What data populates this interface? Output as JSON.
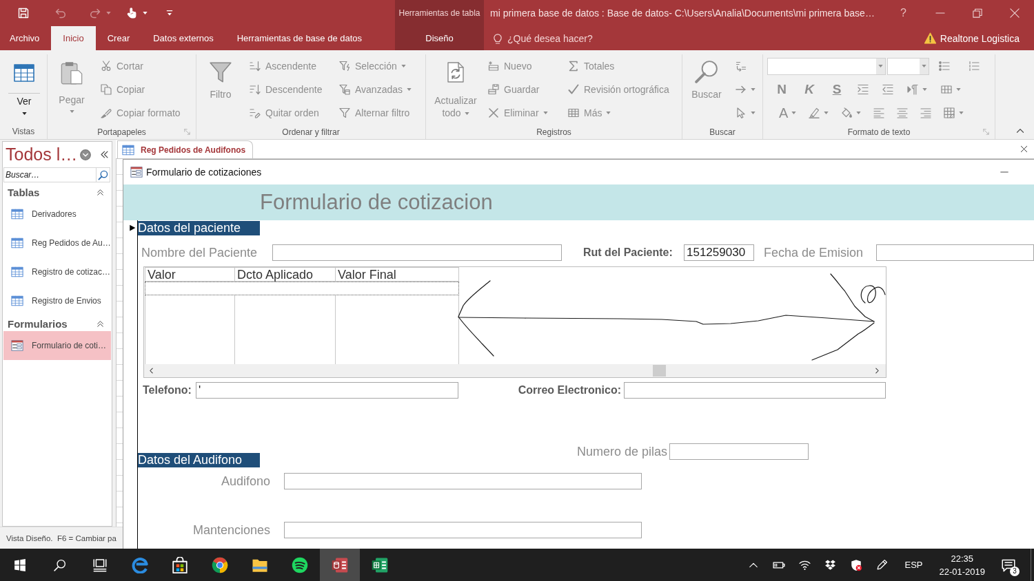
{
  "title_bar": {
    "context_group": "Herramientas de tabla",
    "title": "mi primera base de datos : Base de datos- C:\\Users\\Analia\\Documents\\mi primera base…",
    "help": "?"
  },
  "quick_access": [
    {
      "disabled": false
    },
    {
      "disabled": true
    },
    {
      "disabled": true
    },
    {
      "disabled": false
    }
  ],
  "ribbon_tabs": [
    {
      "label": "Archivo",
      "kind": "main",
      "selected": false
    },
    {
      "label": "Inicio",
      "kind": "main",
      "selected": true
    },
    {
      "label": "Crear",
      "kind": "main",
      "selected": false
    },
    {
      "label": "Datos externos",
      "kind": "main",
      "selected": false
    },
    {
      "label": "Herramientas de base de datos",
      "kind": "main",
      "selected": false
    },
    {
      "label": "Diseño",
      "kind": "context",
      "selected": false
    }
  ],
  "tell_me": {
    "placeholder": "¿Qué desea hacer?"
  },
  "account": {
    "name": "Realtone Logistica"
  },
  "ribbon_groups": [
    {
      "label": "Vistas",
      "launcher": false,
      "commands": [
        {
          "label": "Ver",
          "disabled": false
        }
      ]
    },
    {
      "label": "Portapapeles",
      "launcher": true,
      "commands": [
        {
          "label": "Pegar",
          "disabled": true
        },
        {
          "label": "Cortar",
          "disabled": true
        },
        {
          "label": "Copiar",
          "disabled": true
        },
        {
          "label": "Copiar formato",
          "disabled": true
        }
      ]
    },
    {
      "label": "Ordenar y filtrar",
      "launcher": false,
      "commands": [
        {
          "label": "Filtro",
          "disabled": true
        },
        {
          "label": "Ascendente",
          "disabled": true
        },
        {
          "label": "Descendente",
          "disabled": true
        },
        {
          "label": "Quitar orden",
          "disabled": true
        },
        {
          "label": "Selección",
          "disabled": true
        },
        {
          "label": "Avanzadas",
          "disabled": true
        },
        {
          "label": "Alternar filtro",
          "disabled": true
        }
      ]
    },
    {
      "label": "Registros",
      "launcher": false,
      "commands": [
        {
          "label": "Actualizar todo",
          "disabled": true
        },
        {
          "label": "Nuevo",
          "disabled": true
        },
        {
          "label": "Guardar",
          "disabled": true
        },
        {
          "label": "Eliminar",
          "disabled": true
        },
        {
          "label": "Totales",
          "disabled": true
        },
        {
          "label": "Revisión ortográfica",
          "disabled": true
        },
        {
          "label": "Más",
          "disabled": true
        }
      ]
    },
    {
      "label": "Buscar",
      "launcher": false,
      "commands": [
        {
          "label": "Buscar",
          "disabled": true
        },
        {
          "disabled": true
        },
        {
          "disabled": true
        },
        {
          "disabled": true
        }
      ]
    },
    {
      "label": "Formato de texto",
      "launcher": true,
      "commands": [
        {
          "disabled": true
        },
        {
          "disabled": true
        },
        {
          "disabled": true
        },
        {
          "disabled": true
        },
        {
          "label": "N",
          "disabled": true
        },
        {
          "label": "K",
          "disabled": true
        },
        {
          "label": "S",
          "disabled": true
        },
        {
          "disabled": true
        },
        {
          "disabled": true
        },
        {
          "disabled": true
        },
        {
          "disabled": true
        },
        {
          "label": "A",
          "disabled": true
        },
        {
          "disabled": true
        },
        {
          "disabled": true
        },
        {
          "disabled": true
        },
        {
          "disabled": true
        },
        {
          "disabled": true
        },
        {
          "disabled": true
        }
      ]
    }
  ],
  "nav_pane": {
    "title": "Todos l…",
    "search": {
      "placeholder": "Buscar…"
    },
    "sections": [
      {
        "label": "Tablas",
        "expanded": true,
        "items": [
          {
            "label": "Derivadores",
            "kind": "table",
            "selected": false
          },
          {
            "label": "Reg Pedidos de Au…",
            "kind": "table",
            "selected": false
          },
          {
            "label": "Registro de cotizac…",
            "kind": "table",
            "selected": false
          },
          {
            "label": "Registro de Envios",
            "kind": "table",
            "selected": false
          }
        ]
      },
      {
        "label": "Formularios",
        "expanded": true,
        "items": [
          {
            "label": "Formulario de coti…",
            "kind": "form",
            "selected": true
          }
        ]
      }
    ]
  },
  "status_bar": {
    "text": "Vista Diseño.  F6 = Cambiar pa"
  },
  "document_tabs": [
    {
      "label": "Reg Pedidos de Audifonos",
      "selected": true
    }
  ],
  "form_window": {
    "title": "Formulario de cotizaciones",
    "heading": "Formulario de cotizacion",
    "patient_section": "Datos del paciente",
    "patient_name": {
      "label": "Nombre del Paciente"
    },
    "rut": {
      "label": "Rut del Paciente:",
      "value": "151259030"
    },
    "issue_date": {
      "label": "Fecha de Emision"
    },
    "subform": {
      "columns": [
        "Valor",
        "Dcto Aplicado",
        "Valor Final"
      ]
    },
    "phone": {
      "label": "Telefono:",
      "value": "'"
    },
    "email": {
      "label": "Correo Electronico:"
    },
    "battery_count": {
      "label": "Numero de pilas"
    },
    "hearing_aid_section": "Datos del Audifono",
    "hearing_aid": {
      "label": "Audifono"
    },
    "maintenance": {
      "label": "Mantenciones"
    }
  },
  "taskbar": {
    "buttons": [
      {
        "kind": "start",
        "selected": false
      },
      {
        "kind": "search",
        "selected": false
      },
      {
        "kind": "taskview",
        "selected": false
      },
      {
        "kind": "ebrowser",
        "selected": false
      },
      {
        "kind": "store",
        "selected": false
      },
      {
        "kind": "orb",
        "selected": false
      },
      {
        "kind": "folder",
        "selected": false
      },
      {
        "kind": "music",
        "selected": false
      },
      {
        "kind": "database",
        "selected": true
      },
      {
        "kind": "spreadsheet",
        "selected": false
      }
    ],
    "language": "ESP",
    "time": "22:35",
    "date": "22-01-2019",
    "notification_count": "3"
  }
}
